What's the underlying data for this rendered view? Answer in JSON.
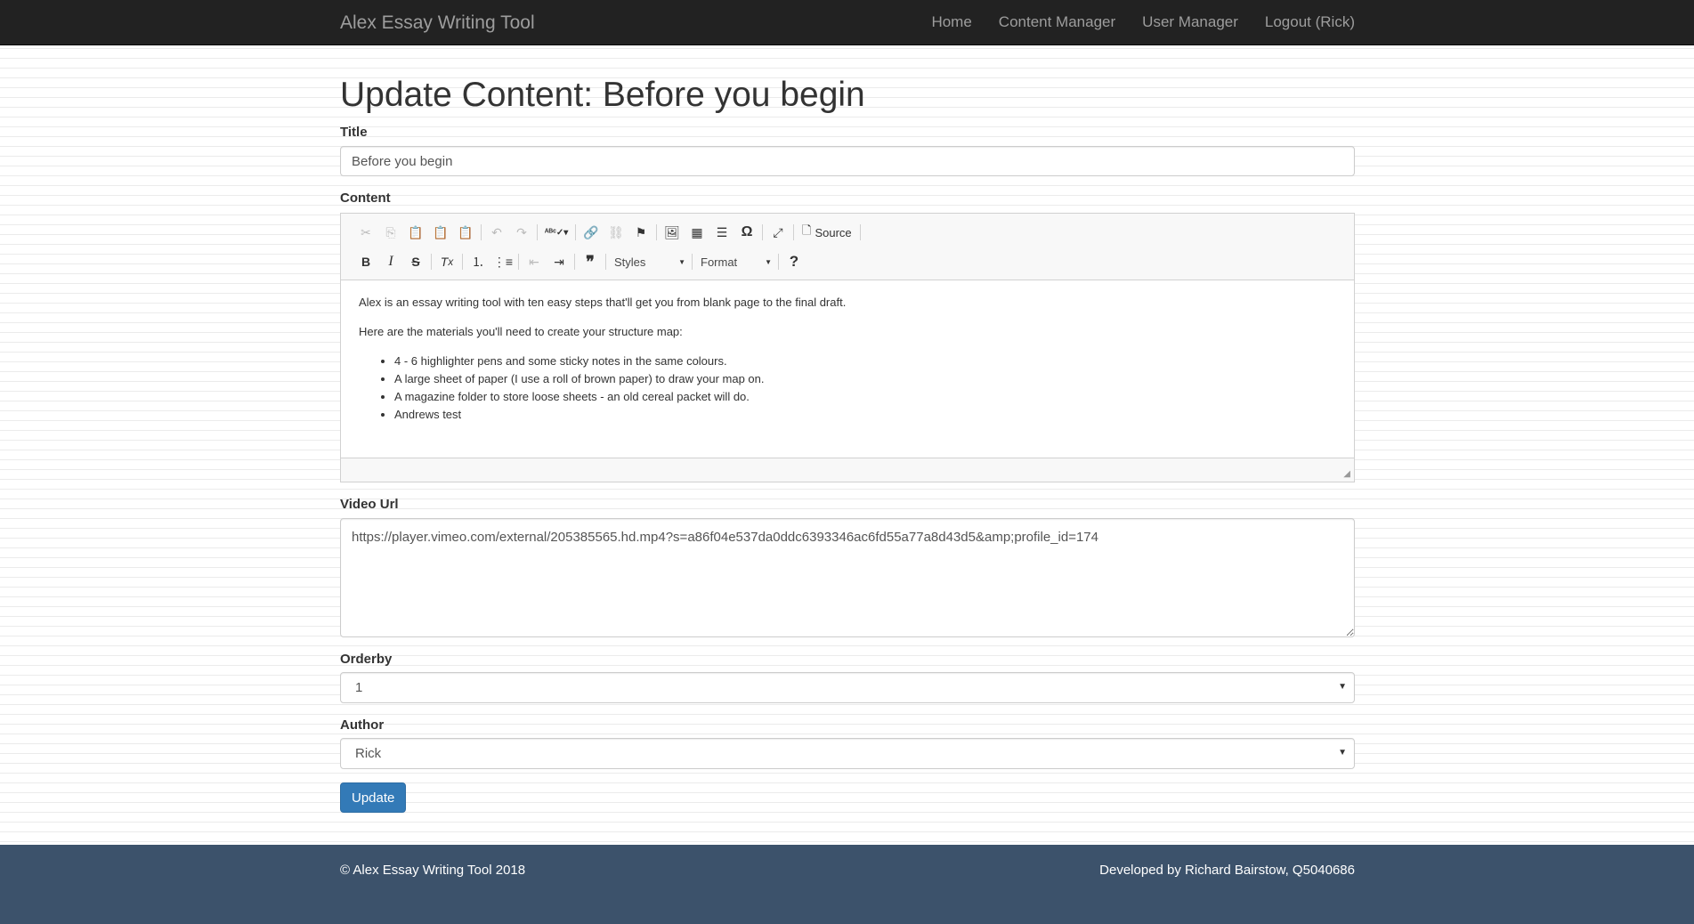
{
  "nav": {
    "brand": "Alex Essay Writing Tool",
    "links": [
      "Home",
      "Content Manager",
      "User Manager",
      "Logout (Rick)"
    ]
  },
  "page": {
    "heading": "Update Content: Before you begin"
  },
  "form": {
    "title_label": "Title",
    "title_value": "Before you begin",
    "content_label": "Content",
    "video_label": "Video Url",
    "video_value": "https://player.vimeo.com/external/205385565.hd.mp4?s=a86f04e537da0ddc6393346ac6fd55a77a8d43d5&amp;profile_id=174",
    "orderby_label": "Orderby",
    "orderby_value": "1",
    "author_label": "Author",
    "author_value": "Rick",
    "submit_label": "Update"
  },
  "editor": {
    "toolbar": {
      "source_label": "Source",
      "styles_label": "Styles",
      "format_label": "Format"
    },
    "paragraphs": [
      "Alex is an essay writing tool with ten easy steps that'll get you from blank page to the final draft.",
      "Here are the materials you'll need to create your structure map:"
    ],
    "list_items": [
      "4 - 6 highlighter pens and some sticky notes in the same colours.",
      "A large sheet of paper (I use a roll of brown paper) to draw your map on.",
      "A magazine folder to store loose sheets - an old cereal packet will do.",
      "Andrews test"
    ]
  },
  "footer": {
    "copyright": "© Alex Essay Writing Tool 2018",
    "credit": "Developed by Richard Bairstow, Q5040686"
  },
  "colors": {
    "navbar": "#222222",
    "primary": "#337ab7",
    "footer": "#3c526b"
  }
}
